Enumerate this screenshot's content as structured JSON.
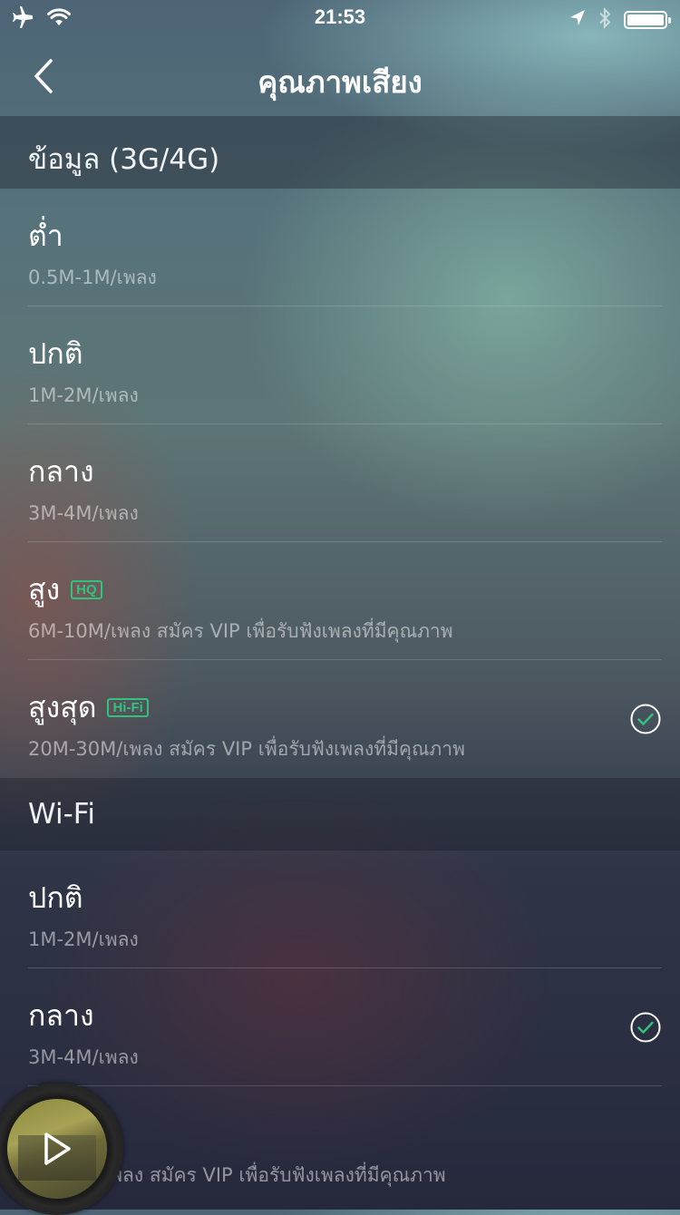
{
  "status_bar": {
    "time": "21:53",
    "left_icons": [
      "airplane-icon",
      "wifi-icon"
    ],
    "right_icons": [
      "location-arrow-icon",
      "bluetooth-icon",
      "battery-icon"
    ]
  },
  "nav": {
    "title": "คุณภาพเสียง",
    "back_icon": "chevron-left-icon"
  },
  "sections": [
    {
      "header": "ข้อมูล (3G/4G)",
      "items": [
        {
          "title": "ต่ำ",
          "subtitle": "0.5M-1M/เพลง",
          "badge": "",
          "checked": false
        },
        {
          "title": "ปกติ",
          "subtitle": "1M-2M/เพลง",
          "badge": "",
          "checked": false
        },
        {
          "title": "กลาง",
          "subtitle": "3M-4M/เพลง",
          "badge": "",
          "checked": false
        },
        {
          "title": "สูง",
          "subtitle": "6M-10M/เพลง สมัคร VIP เพื่อรับฟังเพลงที่มีคุณภาพ",
          "badge": "HQ",
          "checked": false
        },
        {
          "title": "สูงสุด",
          "subtitle": "20M-30M/เพลง สมัคร VIP เพื่อรับฟังเพลงที่มีคุณภาพ",
          "badge": "Hi-Fi",
          "checked": true
        }
      ]
    },
    {
      "header": "Wi-Fi",
      "items": [
        {
          "title": "ปกติ",
          "subtitle": "1M-2M/เพลง",
          "badge": "",
          "checked": false
        },
        {
          "title": "กลาง",
          "subtitle": "3M-4M/เพลง",
          "badge": "",
          "checked": true
        },
        {
          "title": "",
          "subtitle": "เพลง สมัคร VIP เพื่อรับฟังเพลงที่มีคุณภาพ",
          "badge": "",
          "checked": false
        }
      ]
    }
  ],
  "mini_player": {
    "play_icon": "play-icon"
  },
  "colors": {
    "accent": "#31c27c",
    "text_primary": "#ffffff",
    "text_secondary": "rgba(255,255,255,0.5)"
  }
}
